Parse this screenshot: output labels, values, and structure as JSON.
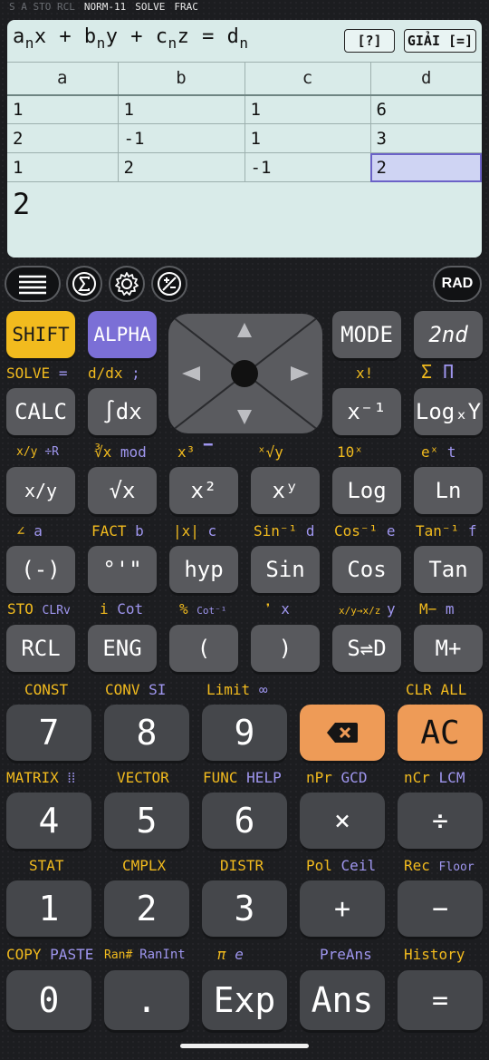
{
  "status": {
    "left_dim": "S  A  STO  RCL",
    "indicators": [
      "NORM-11",
      "SOLVE",
      "FRAC"
    ]
  },
  "screen": {
    "equation": {
      "a": "a",
      "x": "x",
      "b": "b",
      "y": "y",
      "c": "c",
      "z": "z",
      "d": "d",
      "n": "n",
      "plus": "+",
      "eq": "="
    },
    "help_label": "[?]",
    "solve_label": "GIẢI [=]",
    "columns": [
      "a",
      "b",
      "c",
      "d"
    ],
    "rows": [
      [
        "1",
        "1",
        "1",
        "6"
      ],
      [
        "2",
        "-1",
        "1",
        "3"
      ],
      [
        "1",
        "2",
        "-1",
        "2"
      ]
    ],
    "result": "2"
  },
  "toolbar": {
    "rad_label": "RAD",
    "icons": [
      "menu-icon",
      "sigma-icon",
      "gear-icon",
      "plus-minus-icon"
    ]
  },
  "keys": {
    "shift": "SHIFT",
    "alpha": "ALPHA",
    "mode": "MODE",
    "second": "2nd",
    "calc": "CALC",
    "integral": "∫dx",
    "inverse": "x⁻¹",
    "logxy": "LogₓY",
    "frac": "x/y",
    "sqrt": "√x",
    "square": "x²",
    "power": "xʸ",
    "log": "Log",
    "ln": "Ln",
    "neg": "(-)",
    "dms": "°'\"",
    "hyp": "hyp",
    "sin": "Sin",
    "cos": "Cos",
    "tan": "Tan",
    "rcl": "RCL",
    "eng": "ENG",
    "lparen": "(",
    "rparen": ")",
    "sd": "S⇌D",
    "mplus": "M+",
    "d7": "7",
    "d8": "8",
    "d9": "9",
    "ac": "AC",
    "d4": "4",
    "d5": "5",
    "d6": "6",
    "times": "×",
    "divide": "÷",
    "d1": "1",
    "d2": "2",
    "d3": "3",
    "plus": "+",
    "minus": "−",
    "d0": "0",
    "dot": ".",
    "exp": "Exp",
    "ans": "Ans",
    "equals": "="
  },
  "labels": {
    "r1": {
      "solve": "SOLVE",
      "eq": "=",
      "ddx": "d/dx",
      "semi": ";",
      "xfact": "x!",
      "sigma": "Σ",
      "pi_big": "Π"
    },
    "r2": {
      "xy": "x/y",
      "divR": "÷R",
      "cbrt": "∛x",
      "mod": "mod",
      "x3": "x³",
      "bar": "▔",
      "xrt": "ˣ√y",
      "ten": "10ˣ",
      "ex": "eˣ",
      "t": "t"
    },
    "r3": {
      "angle": "∠",
      "a": "a",
      "fact": "FACT",
      "b": "b",
      "abs": "|x|",
      "c": "c",
      "asin": "Sin⁻¹",
      "d": "d",
      "acos": "Cos⁻¹",
      "e": "e",
      "atan": "Tan⁻¹",
      "f": "f"
    },
    "r4": {
      "sto": "STO",
      "clrv": "CLRv",
      "i": "i",
      "cot": "Cot",
      "pct": "%",
      "acot": "Cot⁻¹",
      "comma": "❜",
      "x": "x",
      "conv": "x/y→x/z",
      "y": "y",
      "mminus": "M−",
      "m": "m"
    },
    "r5": {
      "const": "CONST",
      "conv": "CONV",
      "si": "SI",
      "limit": "Limit",
      "inf": "∞",
      "clrall": "CLR ALL"
    },
    "r6": {
      "matrix": "MATRIX",
      "vector": "VECTOR",
      "func": "FUNC",
      "help": "HELP",
      "npr": "nPr",
      "gcd": "GCD",
      "ncr": "nCr",
      "lcm": "LCM"
    },
    "r7": {
      "stat": "STAT",
      "cmplx": "CMPLX",
      "distr": "DISTR",
      "pol": "Pol",
      "ceil": "Ceil",
      "rec": "Rec",
      "floor": "Floor"
    },
    "r8": {
      "copy": "COPY",
      "paste": "PASTE",
      "ranh": "Ran#",
      "ranint": "RanInt",
      "pi": "π",
      "e": "e",
      "preans": "PreAns",
      "history": "History"
    }
  }
}
